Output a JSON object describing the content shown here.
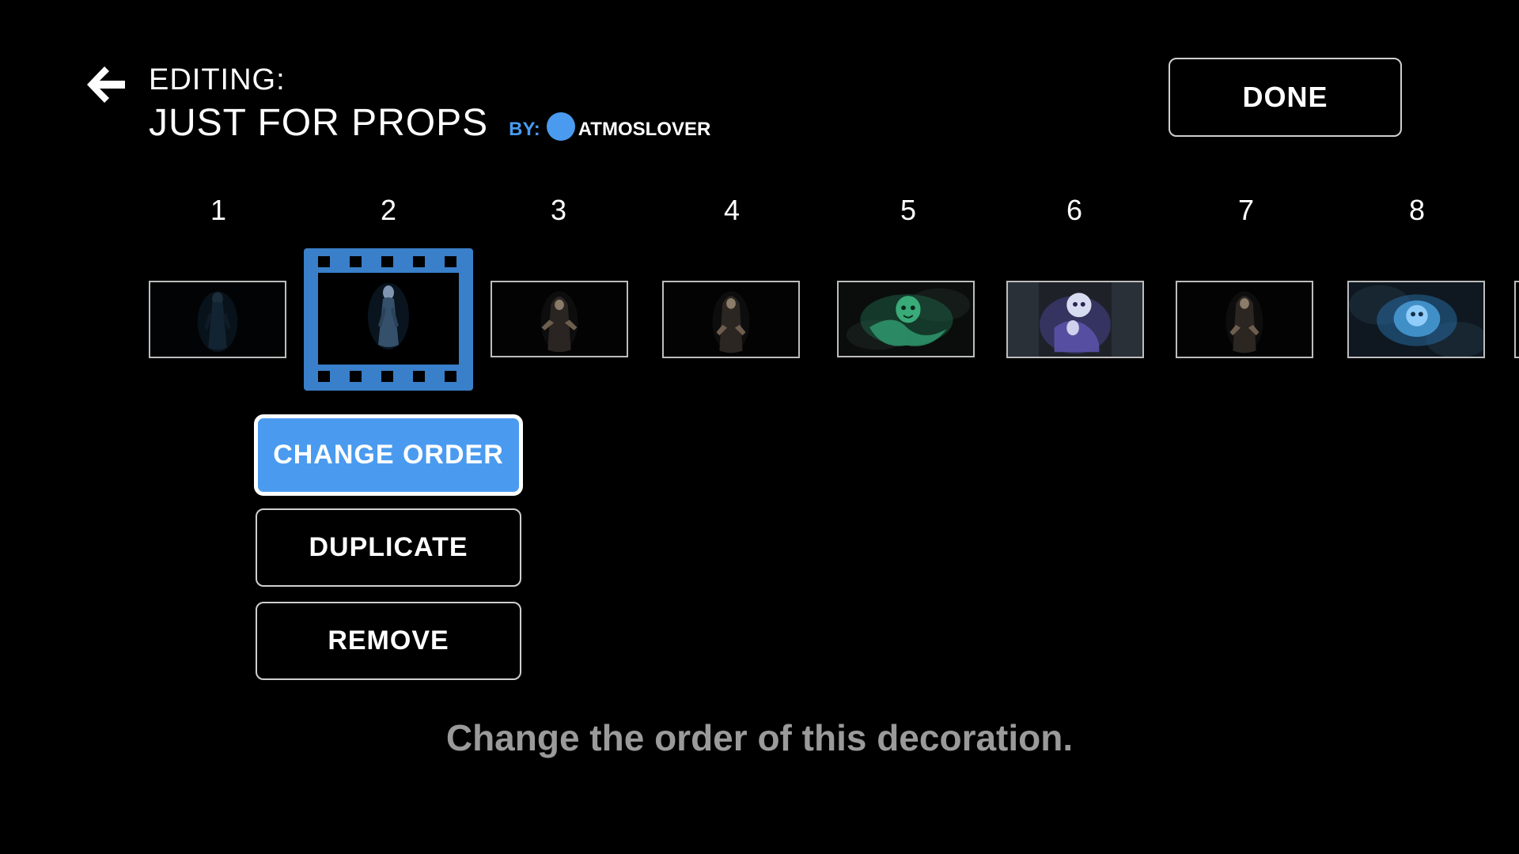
{
  "header": {
    "back_icon": "arrow-left-icon",
    "editing_label": "EDITING:",
    "playlist_title": "JUST FOR PROPS",
    "by_label": "BY:",
    "author_name": "ATMOSLOVER",
    "done_label": "DONE"
  },
  "decorations": [
    {
      "number": "1",
      "theme": "dark-hooded-figure"
    },
    {
      "number": "2",
      "theme": "pale-ghost-figure",
      "selected": true
    },
    {
      "number": "3",
      "theme": "hooded-witch"
    },
    {
      "number": "4",
      "theme": "hooded-witch"
    },
    {
      "number": "5",
      "theme": "green-ghoul"
    },
    {
      "number": "6",
      "theme": "purple-phantom"
    },
    {
      "number": "7",
      "theme": "hooded-witch"
    },
    {
      "number": "8",
      "theme": "blue-spirit"
    }
  ],
  "menu": {
    "change_order_label": "CHANGE ORDER",
    "duplicate_label": "DUPLICATE",
    "remove_label": "REMOVE",
    "focused_item": "change-order"
  },
  "hint": "Change the order of this decoration.",
  "colors": {
    "accent": "#4a9bf0",
    "film_frame": "#3a7fc9",
    "hint_text": "#9a9a9a",
    "background": "#000000"
  }
}
